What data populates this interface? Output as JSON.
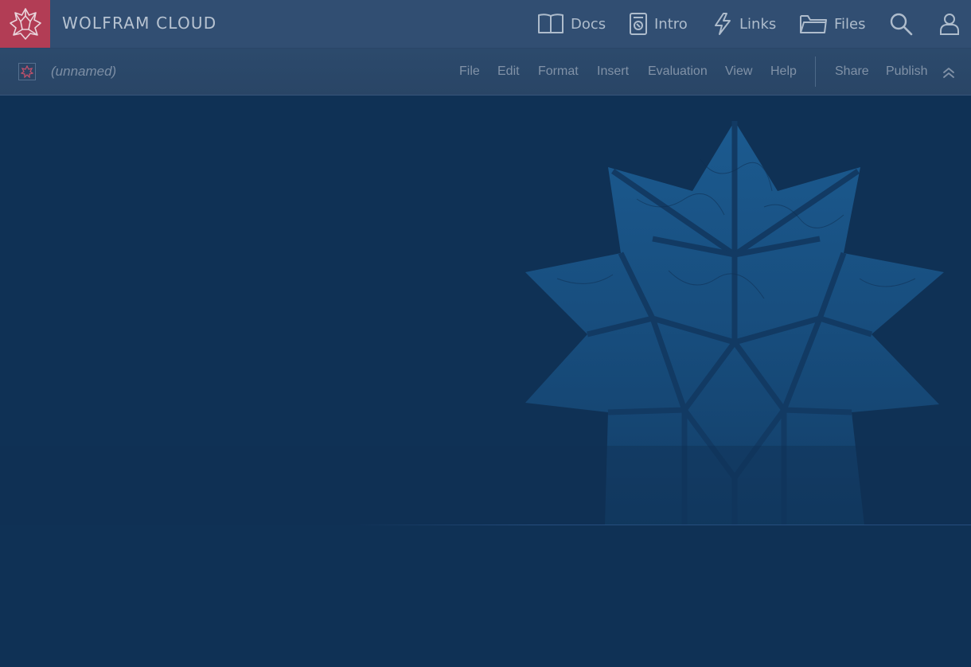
{
  "app": {
    "brand": "WOLFRAM CLOUD",
    "brand_color": "#b23d55"
  },
  "topnav": {
    "items": [
      {
        "label": "Docs",
        "icon": "book-icon"
      },
      {
        "label": "Intro",
        "icon": "intro-document-icon"
      },
      {
        "label": "Links",
        "icon": "lightning-icon"
      },
      {
        "label": "Files",
        "icon": "folder-icon"
      }
    ],
    "search_icon": "search-icon",
    "user_icon": "user-icon"
  },
  "notebook": {
    "name": "(unnamed)",
    "menus": [
      "File",
      "Edit",
      "Format",
      "Insert",
      "Evaluation",
      "View",
      "Help"
    ],
    "actions": [
      "Share",
      "Publish"
    ],
    "collapse_icon": "double-chevron-up-icon"
  },
  "colors": {
    "background": "#0f3155",
    "topbar": "#314e72",
    "toolbar": "#2a4768",
    "spikey_tint": "#1a5a8e"
  }
}
